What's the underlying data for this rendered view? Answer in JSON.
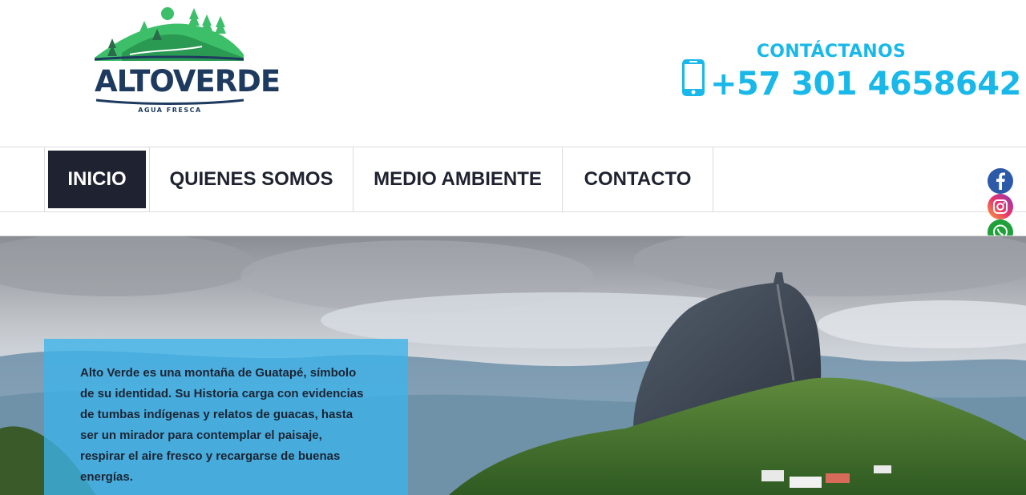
{
  "logo": {
    "name": "ALTOVERDE",
    "tagline": "AGUA FRESCA"
  },
  "contact": {
    "title": "CONTÁCTANOS",
    "phone": "+57 301 4658642"
  },
  "nav": {
    "items": [
      {
        "label": "INICIO",
        "active": true
      },
      {
        "label": "QUIENES SOMOS",
        "active": false
      },
      {
        "label": "MEDIO AMBIENTE",
        "active": false
      },
      {
        "label": "CONTACTO",
        "active": false
      }
    ]
  },
  "social": [
    "facebook-icon",
    "instagram-icon",
    "whatsapp-icon"
  ],
  "hero": {
    "text": "Alto Verde es una montaña de Guatapé, símbolo de su identidad. Su Historia carga con evidencias de tumbas indígenas y relatos de guacas, hasta ser un mirador para contemplar el paisaje, respirar el aire fresco y recargarse de buenas energías."
  },
  "colors": {
    "brand_blue": "#19b8e8",
    "navy": "#1e3a5f",
    "nav_active_bg": "#1f2230",
    "logo_green": "#3dbf6a"
  }
}
